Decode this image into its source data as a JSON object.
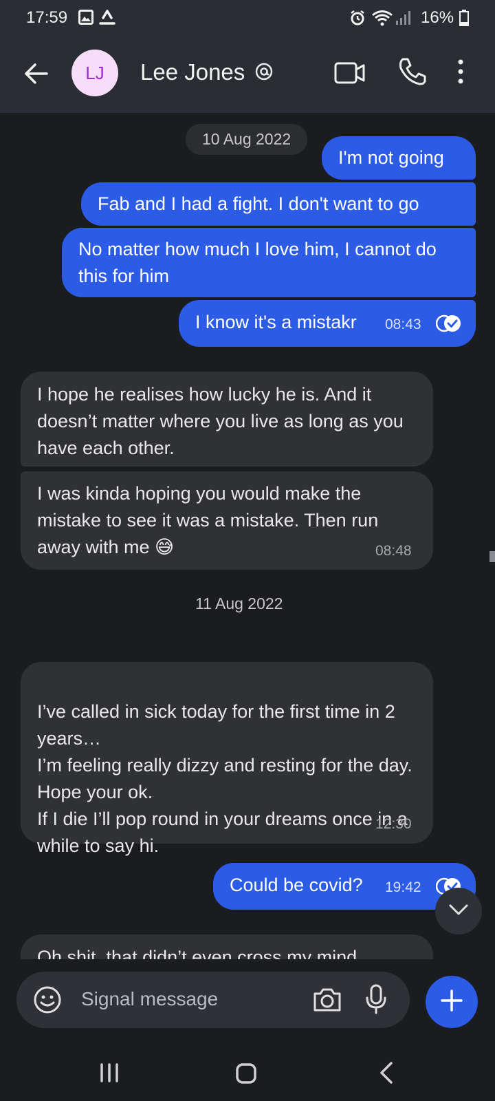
{
  "status_bar": {
    "time": "17:59",
    "battery": "16%",
    "icons": [
      "image-icon",
      "recycle-icon",
      "alarm-icon",
      "wifi-icon",
      "signal-icon",
      "battery-icon"
    ]
  },
  "header": {
    "avatar_initials": "LJ",
    "contact_name": "Lee Jones",
    "icons": [
      "back-arrow-icon",
      "at-badge-icon",
      "video-call-icon",
      "phone-icon",
      "more-vert-icon"
    ]
  },
  "conversation": {
    "dates": [
      "10 Aug 2022",
      "11 Aug 2022"
    ],
    "messages": [
      {
        "direction": "outgoing",
        "text": "I'm not going"
      },
      {
        "direction": "outgoing",
        "text": "Fab and I had a fight. I don't want to go"
      },
      {
        "direction": "outgoing",
        "text": "No matter how much I love him, I cannot do this for him"
      },
      {
        "direction": "outgoing",
        "text": "I know it's a mistakr",
        "time": "08:43",
        "status": "read"
      },
      {
        "direction": "incoming",
        "text": "I hope he realises how lucky he is. And it doesn’t matter where you live as long as you have each other."
      },
      {
        "direction": "incoming",
        "text": "I was kinda hoping you would make the mistake to see it was a mistake. Then run away with me 😅",
        "time": "08:48"
      },
      {
        "direction": "incoming",
        "text": "I’ve called in sick today for the first time in 2 years…\nI’m feeling really dizzy and resting for the day. Hope your ok.\nIf I die I’ll pop round in your dreams once in a while to say hi.",
        "time": "12:30"
      },
      {
        "direction": "outgoing",
        "text": "Could be covid?",
        "time": "19:42",
        "status": "read"
      },
      {
        "direction": "incoming",
        "text": "Oh shit, that didn’t even cross my mind"
      }
    ]
  },
  "composer": {
    "placeholder": "Signal message",
    "icons": [
      "emoji-icon",
      "camera-icon",
      "mic-icon",
      "plus-icon"
    ]
  },
  "colors": {
    "accent": "#2c5ce6",
    "background": "#1b1c1f",
    "header_background": "#2a2d33",
    "incoming_bubble": "#303135",
    "avatar_background": "#f6ddf9",
    "avatar_text": "#a22ccf"
  }
}
